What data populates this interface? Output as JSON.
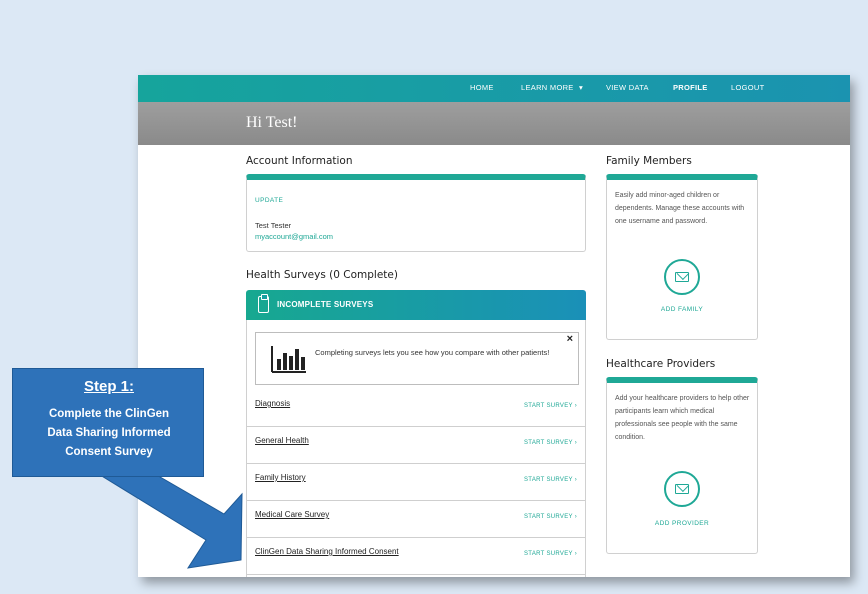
{
  "nav": {
    "home": "HOME",
    "learn_more": "LEARN MORE",
    "learn_more_caret": "▾",
    "view_data": "VIEW DATA",
    "profile": "PROFILE",
    "logout": "LOGOUT"
  },
  "greeting": "Hi Test!",
  "account": {
    "title": "Account Information",
    "update_link": "UPDATE",
    "name": "Test Tester",
    "email": "myaccount@gmail.com"
  },
  "surveys": {
    "title": "Health Surveys (0 Complete)",
    "header": "INCOMPLETE SURVEYS",
    "info_text": "Completing surveys lets you see how you compare with other patients!",
    "close": "×",
    "start_label": "START SURVEY ›",
    "items": [
      {
        "name": "Diagnosis"
      },
      {
        "name": "General Health"
      },
      {
        "name": "Family History"
      },
      {
        "name": "Medical Care Survey"
      },
      {
        "name": "ClinGen Data Sharing Informed Consent"
      }
    ]
  },
  "family": {
    "title": "Family Members",
    "text": "Easily add minor-aged children or dependents. Manage these accounts with one username and password.",
    "button": "ADD FAMILY"
  },
  "providers": {
    "title": "Healthcare Providers",
    "text": "Add your healthcare providers to help other participants learn which medical professionals see people with the same condition.",
    "button": "ADD PROVIDER"
  },
  "callout": {
    "title": "Step 1:",
    "line1": "Complete the ClinGen",
    "line2": "Data Sharing Informed",
    "line3": "Consent Survey"
  },
  "icons": {
    "survey_header": "clipboard-icon",
    "info": "bar-chart-icon",
    "family": "envelope-icon",
    "provider": "envelope-icon"
  },
  "colors": {
    "teal": "#1fa896",
    "nav_gradient_end": "#1b93b0",
    "callout_blue": "#2e72b9",
    "greeting_gray": "#999999",
    "background": "#dce8f5"
  }
}
